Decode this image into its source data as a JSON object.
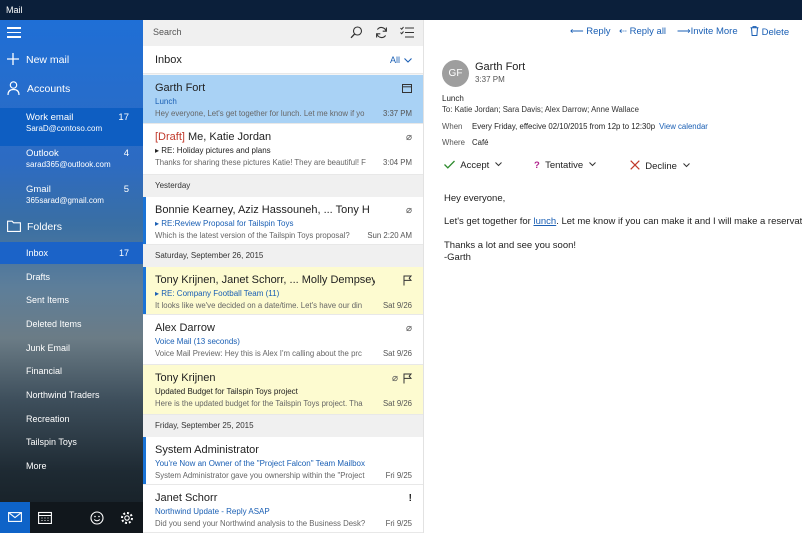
{
  "app": {
    "title": "Mail"
  },
  "nav": {
    "new_mail": "New mail",
    "accounts_label": "Accounts",
    "accounts": [
      {
        "name": "Work email",
        "email": "SaraD@contoso.com",
        "count": "17"
      },
      {
        "name": "Outlook",
        "email": "sarad365@outlook.com",
        "count": "4"
      },
      {
        "name": "Gmail",
        "email": "365sarad@gmail.com",
        "count": "5"
      }
    ],
    "folders_label": "Folders",
    "folders": [
      {
        "name": "Inbox",
        "count": "17"
      },
      {
        "name": "Drafts"
      },
      {
        "name": "Sent Items"
      },
      {
        "name": "Deleted Items"
      },
      {
        "name": "Junk Email"
      },
      {
        "name": "Financial"
      },
      {
        "name": "Northwind Traders"
      },
      {
        "name": "Recreation"
      },
      {
        "name": "Tailspin Toys"
      },
      {
        "name": "More"
      }
    ]
  },
  "list": {
    "search_placeholder": "Search",
    "folder_title": "Inbox",
    "filter": "All",
    "sections": [
      "Yesterday",
      "Saturday, September 26, 2015",
      "Friday, September 25, 2015"
    ],
    "messages": [
      {
        "from": "Garth Fort",
        "subject": "Lunch",
        "preview": "Hey everyone, Let's get together for lunch. Let me know if yo",
        "time": "3:37 PM"
      },
      {
        "draft": "[Draft]",
        "from": "Me, Katie Jordan",
        "subject": "RE: Holiday pictures and plans",
        "preview": "Thanks for sharing these pictures Katie! They are beautiful! F",
        "time": "3:04 PM"
      },
      {
        "from": "Bonnie Kearney, Aziz Hassouneh, ... Tony H",
        "subject": "RE:Review Proposal for Tailspin Toys",
        "preview": "Which is the latest version of the Tailspin Toys proposal?",
        "time": "Sun 2:20 AM"
      },
      {
        "from": "Tony Krijnen, Janet Schorr, ... Molly Dempsey",
        "subject": "RE: Company Football Team (11)",
        "preview": "It looks like we've decided on a date/time. Let's have our din",
        "time": "Sat 9/26"
      },
      {
        "from": "Alex Darrow",
        "subject": "Voice Mail (13 seconds)",
        "preview": "Voice Mail Preview: Hey this is Alex I'm calling about the prc",
        "time": "Sat 9/26"
      },
      {
        "from": "Tony Krijnen",
        "subject": "Updated Budget for Tailspin Toys project",
        "preview": "Here is the updated budget for the Tailspin Toys project. Tha",
        "time": "Sat 9/26"
      },
      {
        "from": "System Administrator",
        "subject": "You're Now an Owner of the \"Project Falcon\" Team Mailbox",
        "preview": "System Administrator gave you ownership within the \"Project",
        "time": "Fri 9/25"
      },
      {
        "from": "Janet Schorr",
        "subject": "Northwind Update - Reply ASAP",
        "preview": "Did you send your Northwind analysis to the Business Desk?",
        "time": "Fri 9/25"
      }
    ]
  },
  "reading": {
    "toolbar": {
      "reply": "Reply",
      "reply_all": "Reply all",
      "invite_more": "Invite More",
      "delete": "Delete"
    },
    "initials": "GF",
    "from": "Garth Fort",
    "time": "3:37 PM",
    "subject": "Lunch",
    "to_label": "To:",
    "to": "Katie Jordan; Sara Davis; Alex Darrow; Anne Wallace",
    "when_label": "When",
    "when": "Every Friday, effecive 02/10/2015 from 12p to 12:30p",
    "view_calendar": "View calendar",
    "where_label": "Where",
    "where": "Café",
    "accept": "Accept",
    "tentative": "Tentative",
    "decline": "Decline",
    "body": {
      "greeting": "Hey everyone,",
      "line1_pre": "Let's get together for ",
      "line1_link": "lunch",
      "line1_post": ". Let me know if you can make it and I will make a reservation a",
      "thanks": "Thanks a lot and see you soon!",
      "sign": "-Garth"
    }
  },
  "colors": {
    "accent": "#1a73d6",
    "selected": "#a9d2f5",
    "flagged": "#fdfbd0",
    "titlebar": "#0b1f3a"
  }
}
